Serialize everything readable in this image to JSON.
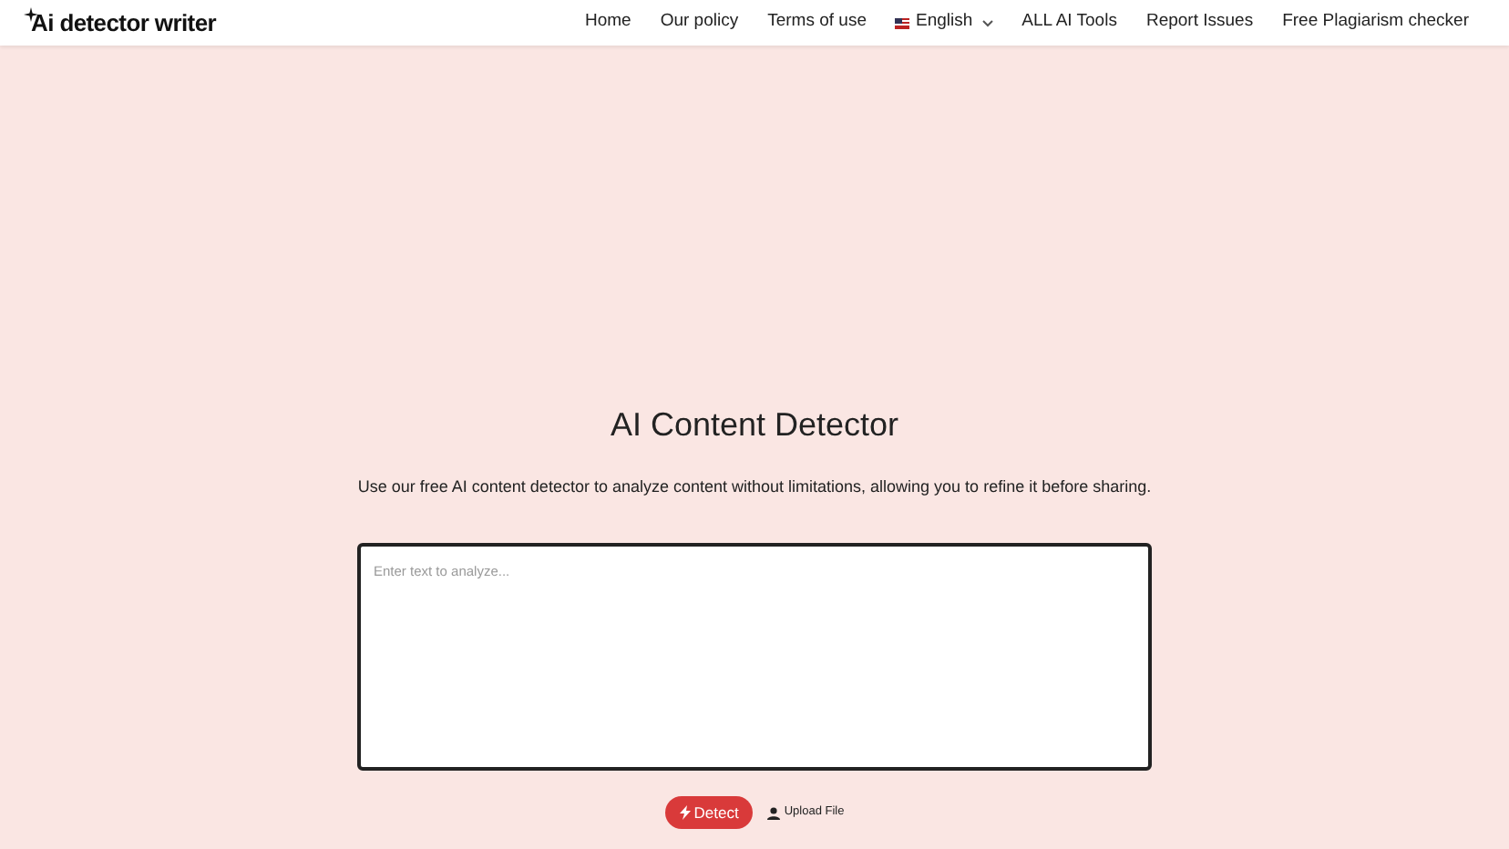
{
  "logo": {
    "text": "Ai detector writer"
  },
  "nav": [
    {
      "label": "Home",
      "kind": "link"
    },
    {
      "label": "Our policy",
      "kind": "link"
    },
    {
      "label": "Terms of use",
      "kind": "link"
    },
    {
      "label": "English",
      "kind": "language"
    },
    {
      "label": "ALL AI Tools",
      "kind": "link"
    },
    {
      "label": "Report Issues",
      "kind": "link"
    },
    {
      "label": "Free Plagiarism checker",
      "kind": "link"
    }
  ],
  "heading": "AI Content Detector",
  "subtitle": "Use our free AI content detector to analyze content without limitations, allowing you to refine it before sharing.",
  "input": {
    "placeholder": "Enter text to analyze..."
  },
  "buttons": [
    {
      "label": "Detect",
      "kind": "primary"
    },
    {
      "label": "Upload File",
      "kind": "upload"
    }
  ]
}
